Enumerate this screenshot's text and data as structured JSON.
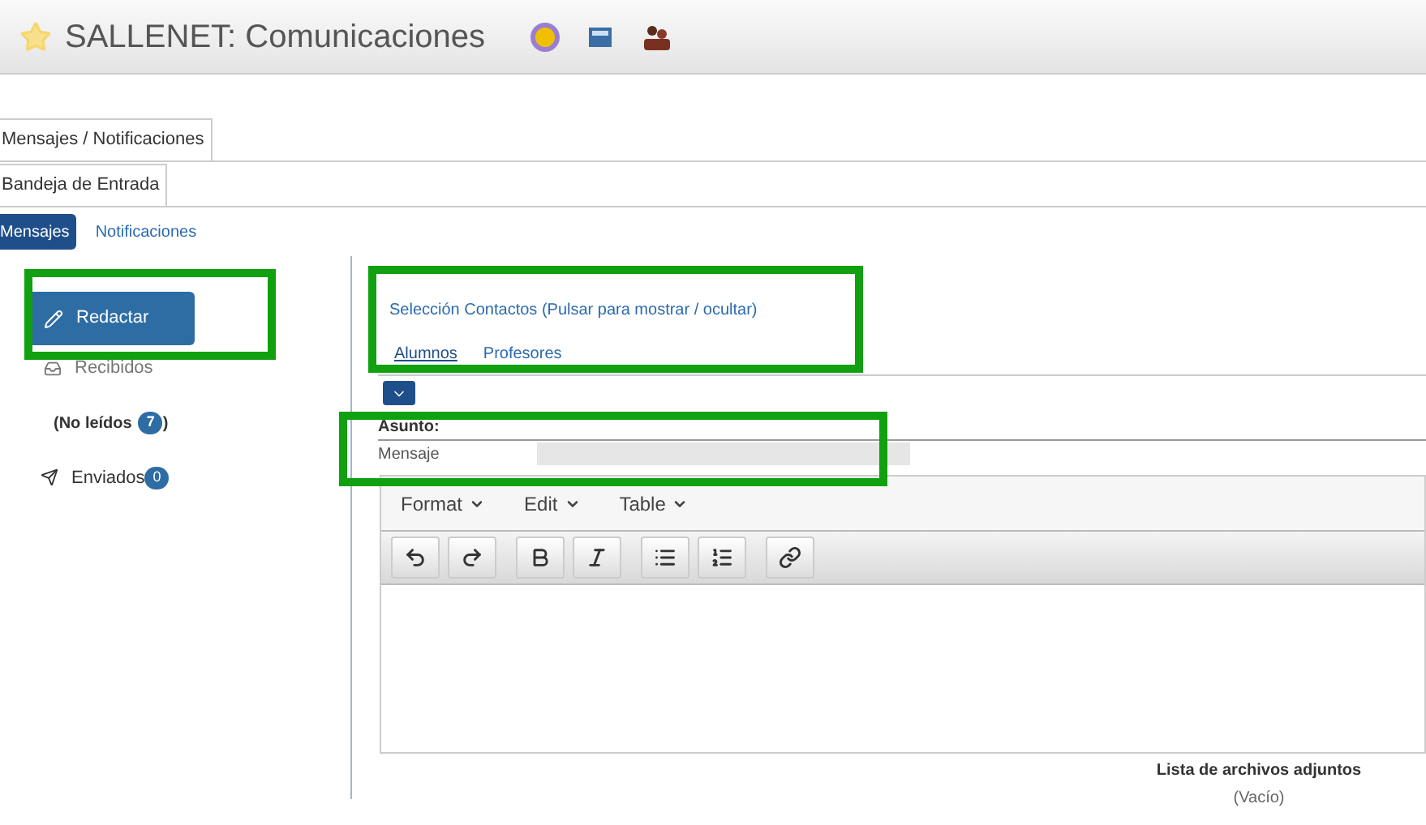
{
  "window": {
    "title": "SALLENET: Comunicaciones"
  },
  "tabs": [
    {
      "label": "Mensajes / Notificaciones",
      "selected": true
    }
  ],
  "subtabs": [
    {
      "label": "Bandeja de Entrada",
      "selected": true
    }
  ],
  "pills": [
    {
      "label": "Mensajes",
      "selected": true
    },
    {
      "label": "Notificaciones",
      "selected": false
    }
  ],
  "sidebar": {
    "compose": "Redactar",
    "items": [
      {
        "kind": "folder",
        "label": "Recibidos"
      },
      {
        "kind": "unread",
        "label": "(No leídos",
        "badge": "7",
        "suffix": ")"
      },
      {
        "kind": "sent",
        "label": "Enviados",
        "badge": "0"
      }
    ]
  },
  "contacts": {
    "toggle": "Selección Contactos (Pulsar para mostrar / ocultar)",
    "tabs": [
      {
        "label": "Alumnos",
        "selected": true
      },
      {
        "label": "Profesores",
        "selected": false
      }
    ]
  },
  "subject": {
    "label": "Asunto:",
    "value": "Mensaje"
  },
  "editor": {
    "menus": [
      "Format",
      "Edit",
      "Table"
    ]
  },
  "attachments": {
    "title": "Lista de archivos adjuntos",
    "status": "(Vacío)"
  }
}
